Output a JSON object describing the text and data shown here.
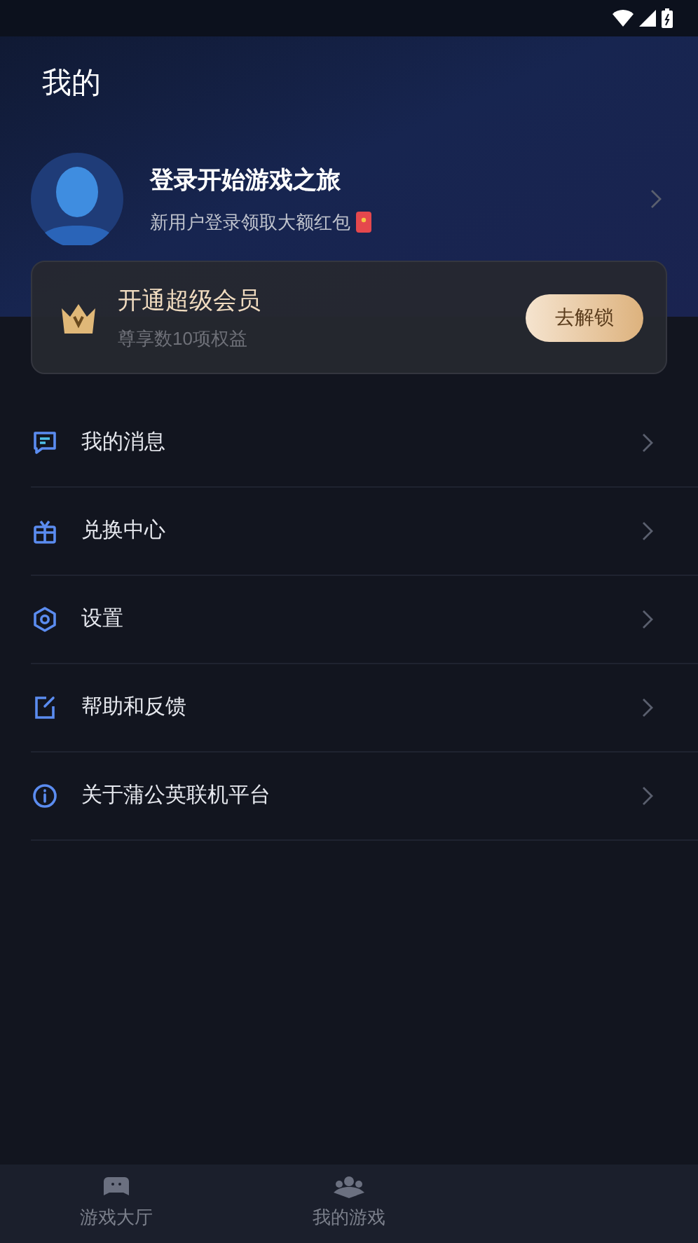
{
  "page_title": "我的",
  "profile": {
    "title": "登录开始游戏之旅",
    "subtitle": "新用户登录领取大额红包"
  },
  "vip": {
    "title": "开通超级会员",
    "subtitle": "尊享数10项权益",
    "button": "去解锁"
  },
  "menu": [
    {
      "label": "我的消息",
      "kind": "message"
    },
    {
      "label": "兑换中心",
      "kind": "gift"
    },
    {
      "label": "设置",
      "kind": "settings"
    },
    {
      "label": "帮助和反馈",
      "kind": "edit"
    },
    {
      "label": "关于蒲公英联机平台",
      "kind": "info"
    }
  ],
  "bottom_nav": [
    {
      "label": "游戏大厅",
      "kind": "gamepad",
      "selected": false
    },
    {
      "label": "我的游戏",
      "kind": "people",
      "selected": false
    }
  ]
}
